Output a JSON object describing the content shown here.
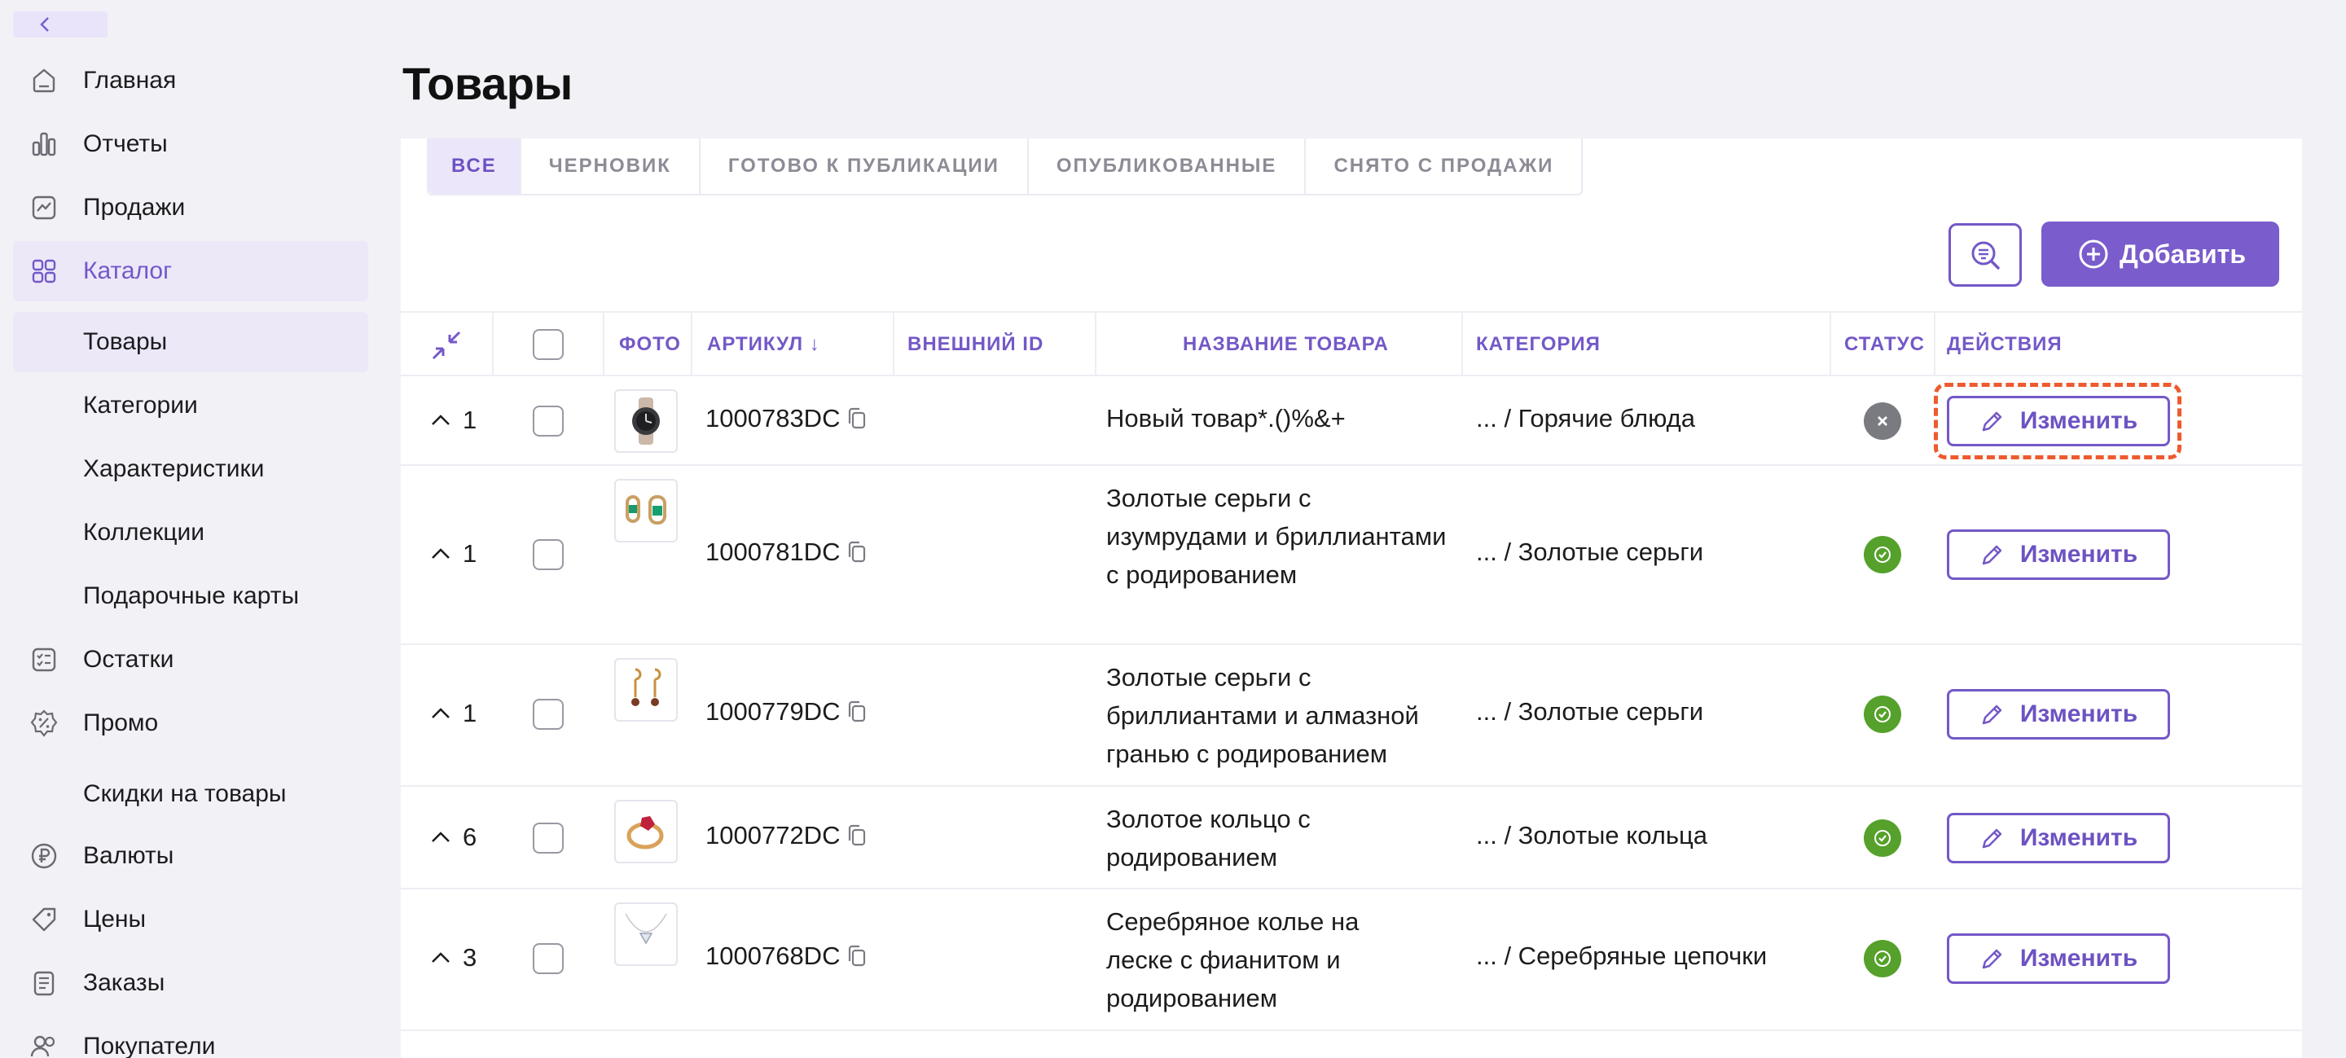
{
  "sidebar": {
    "collapse_icon": "chevron-left-icon",
    "items": [
      {
        "label": "Главная",
        "icon": "home-icon"
      },
      {
        "label": "Отчеты",
        "icon": "bar-chart-icon"
      },
      {
        "label": "Продажи",
        "icon": "sales-chart-icon"
      },
      {
        "label": "Каталог",
        "icon": "grid-icon"
      },
      {
        "label": "Товары"
      },
      {
        "label": "Категории"
      },
      {
        "label": "Характеристики"
      },
      {
        "label": "Коллекции"
      },
      {
        "label": "Подарочные карты"
      },
      {
        "label": "Остатки",
        "icon": "checklist-icon"
      },
      {
        "label": "Промо",
        "icon": "percent-badge-icon"
      },
      {
        "label": "Скидки на товары"
      },
      {
        "label": "Валюты",
        "icon": "ruble-icon"
      },
      {
        "label": "Цены",
        "icon": "price-tag-icon"
      },
      {
        "label": "Заказы",
        "icon": "orders-icon"
      },
      {
        "label": "Покупатели",
        "icon": "users-icon"
      }
    ]
  },
  "page": {
    "title": "Товары"
  },
  "tabs": [
    "ВСЕ",
    "ЧЕРНОВИК",
    "ГОТОВО К ПУБЛИКАЦИИ",
    "ОПУБЛИКОВАННЫЕ",
    "СНЯТО С ПРОДАЖИ"
  ],
  "toolbar": {
    "add_label": "Добавить",
    "search_icon": "search-filter-icon",
    "add_icon": "plus-circle-icon"
  },
  "table": {
    "columns": {
      "photo": "ФОТО",
      "sku": "АРТИКУЛ ↓",
      "external_id": "ВНЕШНИЙ ID",
      "name": "НАЗВАНИЕ ТОВАРА",
      "category": "КАТЕГОРИЯ",
      "status": "СТАТУС",
      "actions": "ДЕЙСТВИЯ"
    },
    "edit_label": "Изменить",
    "rows": [
      {
        "count": "1",
        "sku": "1000783DC",
        "name": "Новый товар*.()%&+",
        "category": "... / Горячие блюда",
        "status": "inactive",
        "photo": "watch"
      },
      {
        "count": "1",
        "sku": "1000781DC",
        "name": "Золотые серьги с изумрудами и бриллиантами с родированием",
        "category": "... / Золотые серьги",
        "status": "active",
        "photo": "emerald-earrings"
      },
      {
        "count": "1",
        "sku": "1000779DC",
        "name": "Золотые серьги с бриллиантами и алмазной гранью с родированием",
        "category": "... / Золотые серьги",
        "status": "active",
        "photo": "drop-earrings"
      },
      {
        "count": "6",
        "sku": "1000772DC",
        "name": "Золотое кольцо с родированием",
        "category": "... / Золотые кольца",
        "status": "active",
        "photo": "ring"
      },
      {
        "count": "3",
        "sku": "1000768DC",
        "name": "Серебряное колье на леске с фианитом и родированием",
        "category": "... / Серебряные цепочки",
        "status": "active",
        "photo": "necklace"
      }
    ]
  },
  "colors": {
    "accent": "#7458c8",
    "active_status": "#55a12b",
    "inactive_status": "#7a7b80",
    "highlight": "#ee5a2e"
  }
}
